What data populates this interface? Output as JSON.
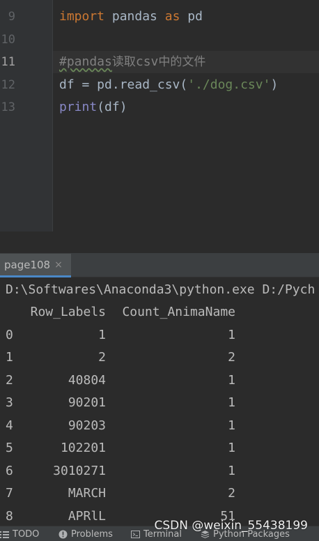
{
  "editor": {
    "lines": [
      {
        "num": "9",
        "tokens": [
          {
            "t": "import",
            "c": "kw"
          },
          {
            "t": " pandas ",
            "c": "pl"
          },
          {
            "t": "as",
            "c": "kw"
          },
          {
            "t": " pd",
            "c": "pl"
          }
        ]
      },
      {
        "num": "10",
        "tokens": []
      },
      {
        "num": "11",
        "tokens": [
          {
            "t": "#pandas",
            "c": "cm"
          },
          {
            "t": "读取",
            "c": "cm"
          },
          {
            "t": "csv",
            "c": "cm"
          },
          {
            "t": "中的文件",
            "c": "cm"
          }
        ]
      },
      {
        "num": "12",
        "tokens": [
          {
            "t": "df = pd.read_csv(",
            "c": "pl"
          },
          {
            "t": "'./dog.csv'",
            "c": "str"
          },
          {
            "t": ")",
            "c": "pl"
          }
        ]
      },
      {
        "num": "13",
        "tokens": [
          {
            "t": "print",
            "c": "bi"
          },
          {
            "t": "(df)",
            "c": "pl"
          }
        ]
      }
    ]
  },
  "run": {
    "tab_label": "page108",
    "tab_close": "×",
    "command": "D:\\Softwares\\Anaconda3\\python.exe D:/Pych",
    "headers": {
      "row_labels": "Row_Labels",
      "count": "Count_AnimaName"
    },
    "rows": [
      {
        "idx": "0",
        "row": "1",
        "count": "1"
      },
      {
        "idx": "1",
        "row": "2",
        "count": "2"
      },
      {
        "idx": "2",
        "row": "40804",
        "count": "1"
      },
      {
        "idx": "3",
        "row": "90201",
        "count": "1"
      },
      {
        "idx": "4",
        "row": "90203",
        "count": "1"
      },
      {
        "idx": "5",
        "row": "102201",
        "count": "1"
      },
      {
        "idx": "6",
        "row": "3010271",
        "count": "1"
      },
      {
        "idx": "7",
        "row": "MARCH",
        "count": "2"
      },
      {
        "idx": "8",
        "row": "APRlL",
        "count": "51"
      }
    ]
  },
  "bottom_bar": {
    "todo": "TODO",
    "problems": "Problems",
    "terminal": "Terminal",
    "python_packages": "Python Packages"
  },
  "watermark": "CSDN @weixin_55438199",
  "colors": {
    "editor_bg": "#2b2b2b",
    "keyword": "#cc7832",
    "string": "#6a8759",
    "comment": "#808080",
    "builtin": "#8888c6",
    "tab_underline": "#4a88c7"
  }
}
